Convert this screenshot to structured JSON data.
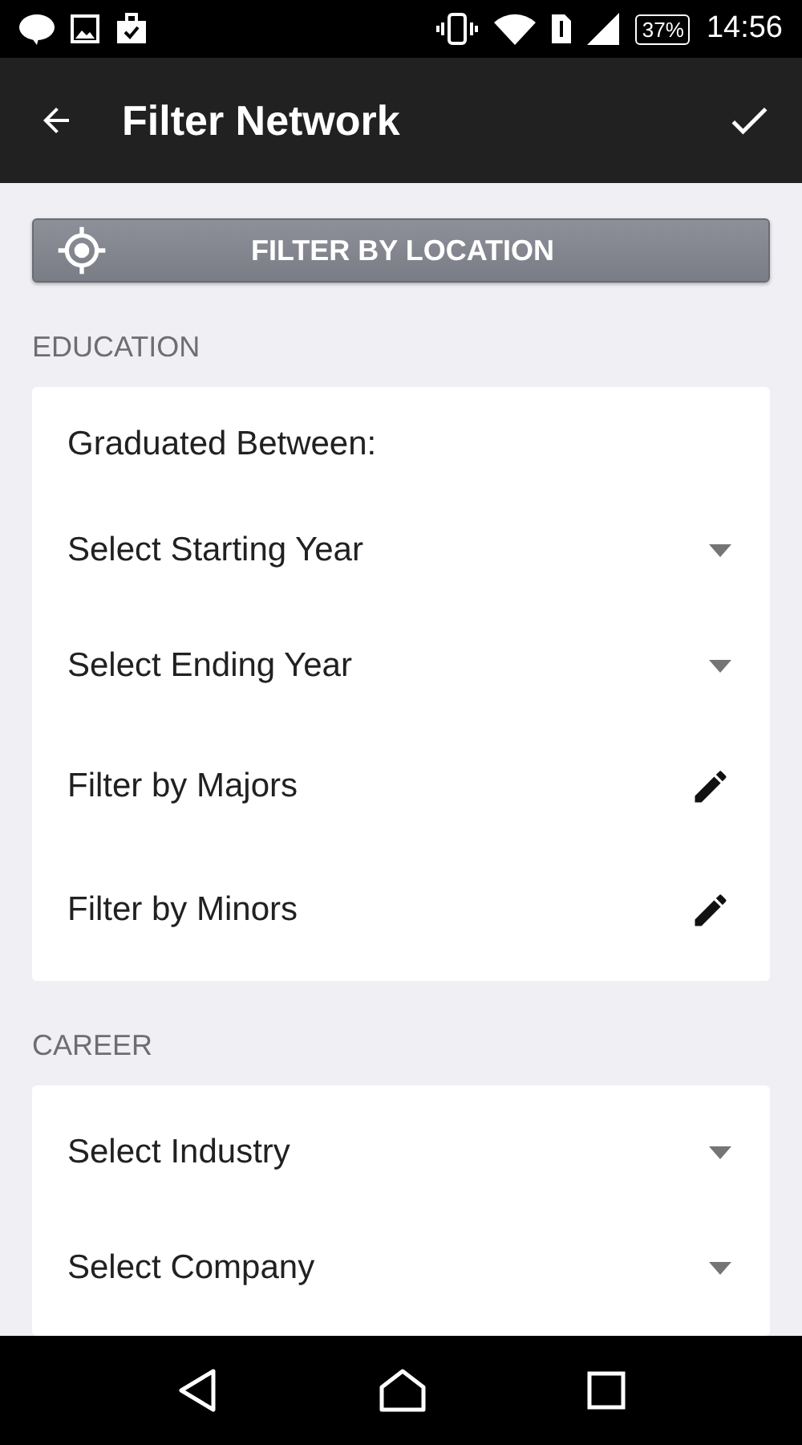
{
  "status_bar": {
    "battery": "37%",
    "time": "14:56"
  },
  "app_bar": {
    "title": "Filter Network"
  },
  "location_button": {
    "label": "FILTER BY LOCATION"
  },
  "sections": [
    {
      "title": "EDUCATION",
      "rows": [
        {
          "kind": "label",
          "text": "Graduated Between:"
        },
        {
          "kind": "dropdown",
          "text": "Select Starting Year"
        },
        {
          "kind": "dropdown",
          "text": "Select Ending Year"
        },
        {
          "kind": "edit",
          "text": "Filter by Majors"
        },
        {
          "kind": "edit",
          "text": "Filter by Minors"
        }
      ]
    },
    {
      "title": "CAREER",
      "rows": [
        {
          "kind": "dropdown",
          "text": "Select Industry"
        },
        {
          "kind": "dropdown",
          "text": "Select Company"
        }
      ]
    }
  ]
}
